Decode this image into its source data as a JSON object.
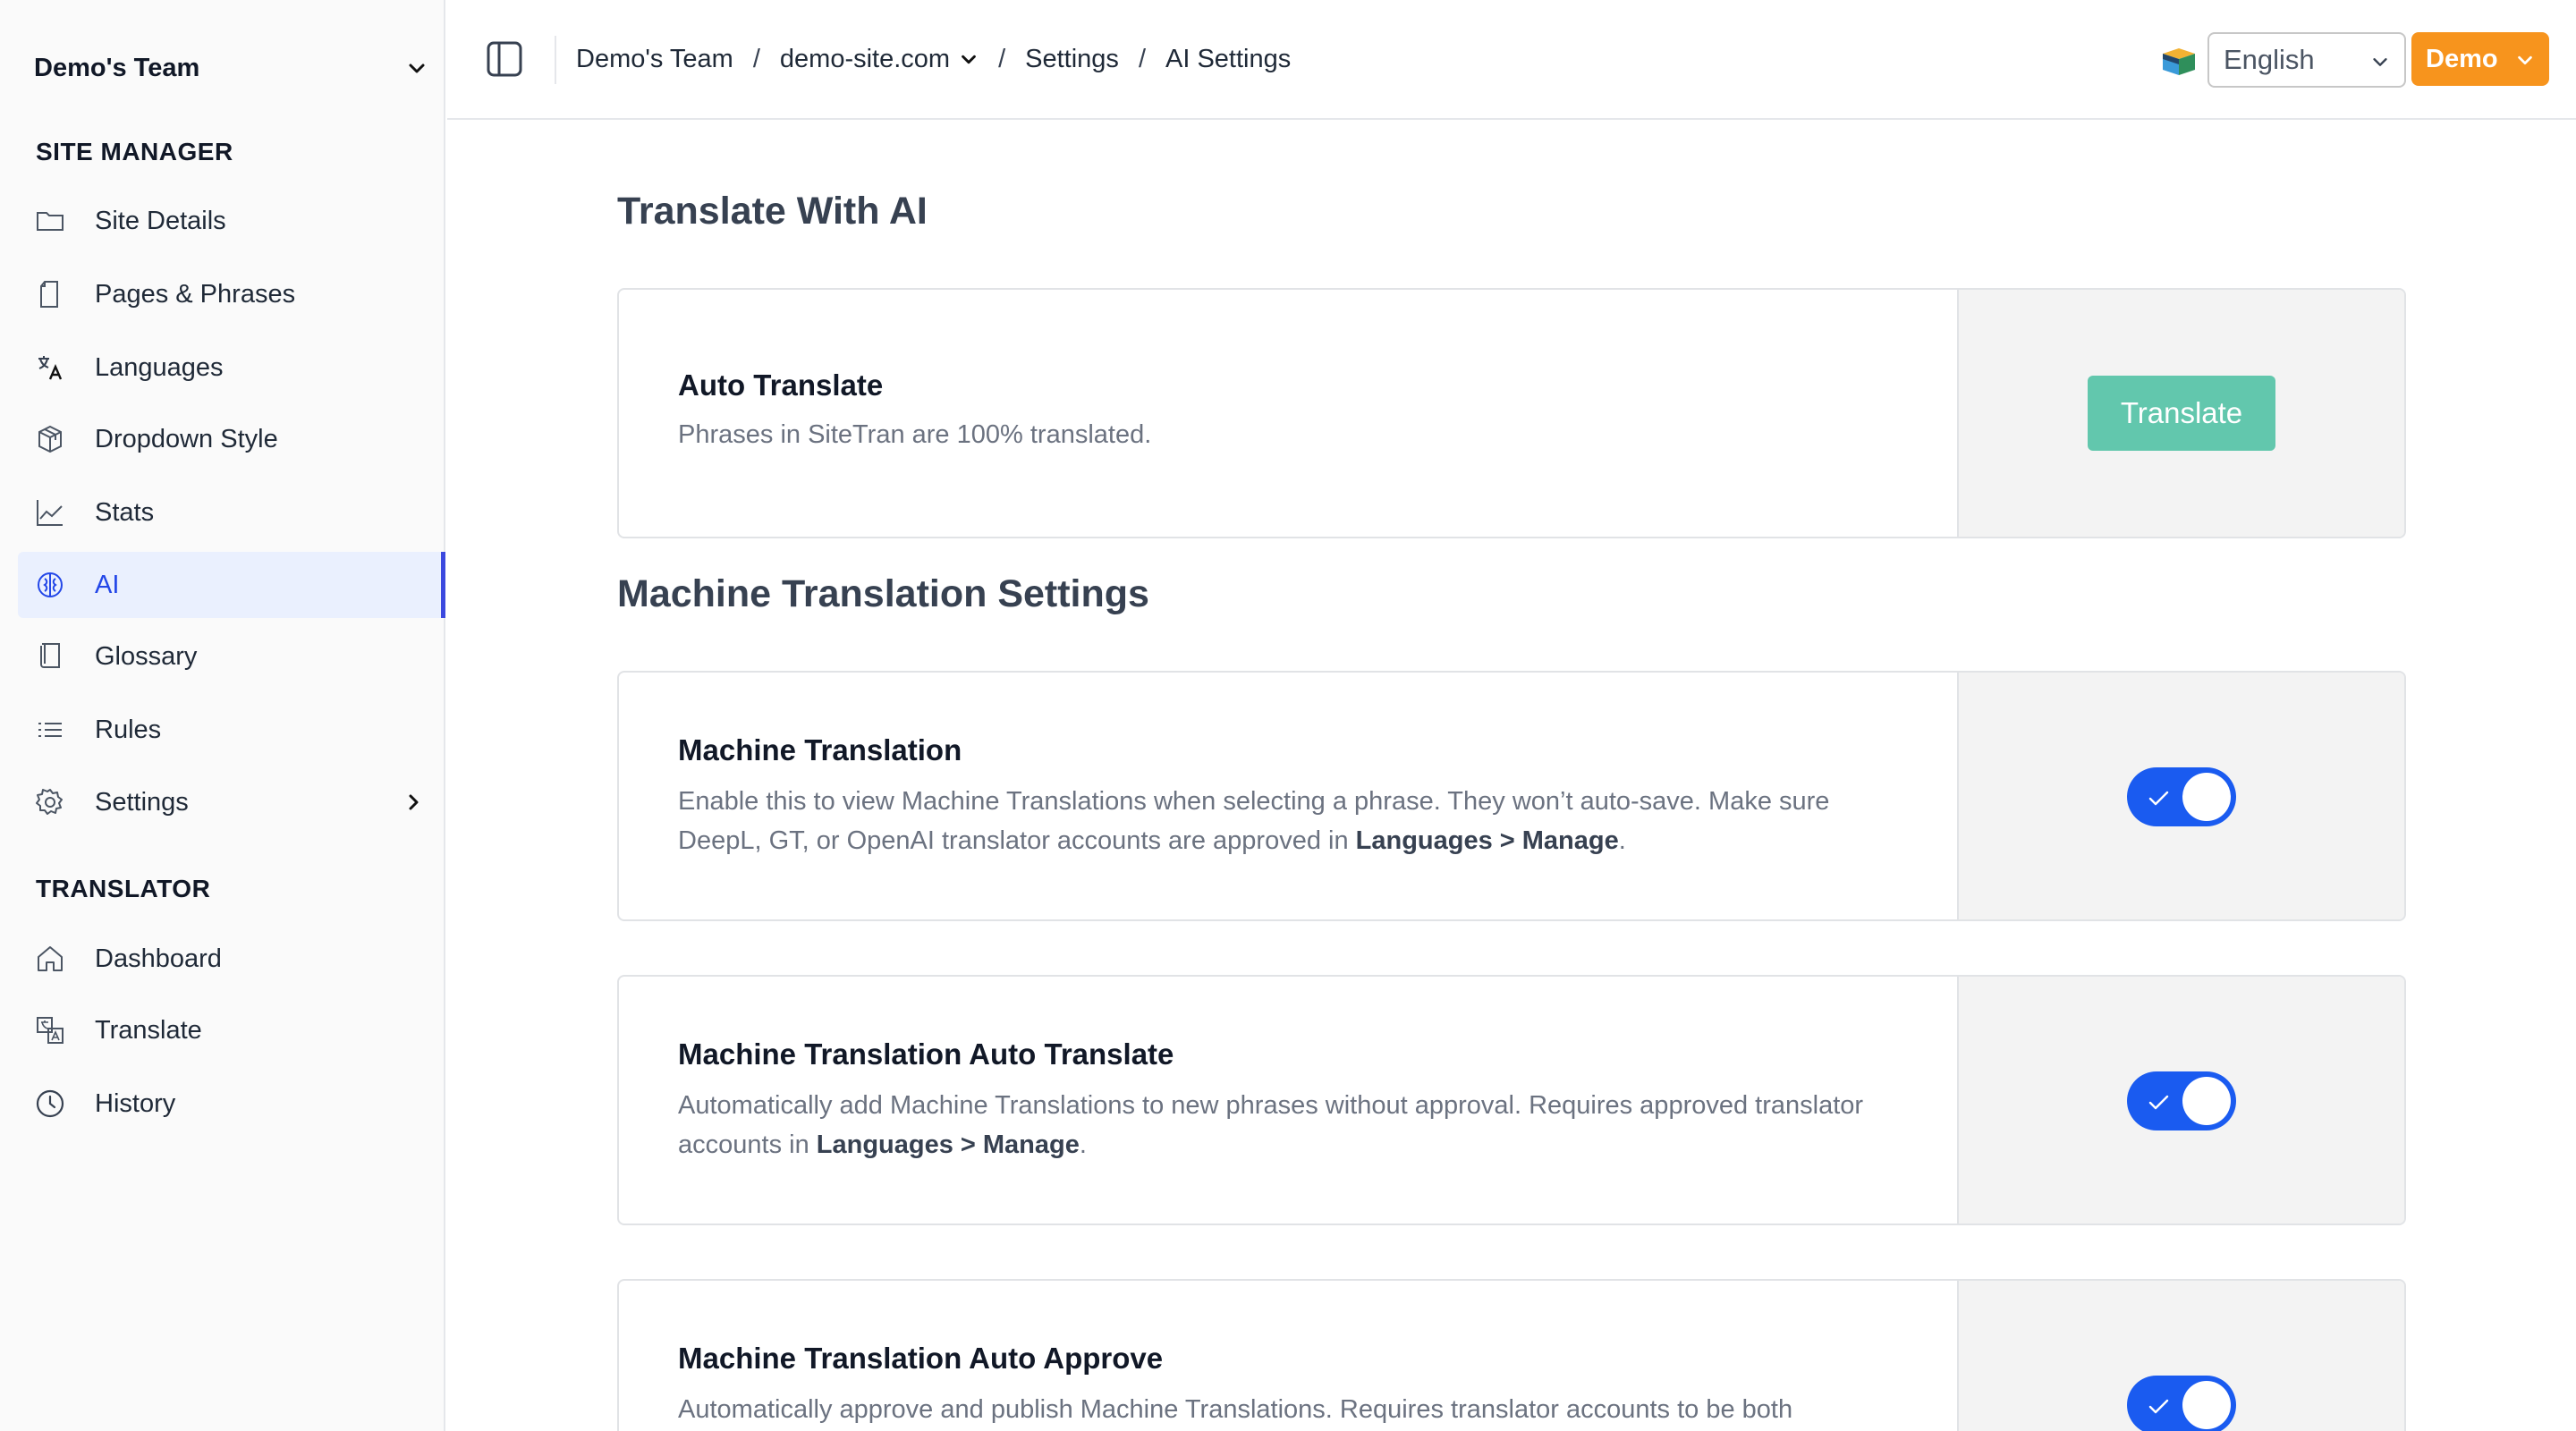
{
  "sidebar": {
    "team_name": "Demo's Team",
    "sections": [
      {
        "title": "SITE MANAGER"
      },
      {
        "title": "TRANSLATOR"
      }
    ],
    "items": [
      {
        "label": "Site Details",
        "icon": "folder-icon"
      },
      {
        "label": "Pages & Phrases",
        "icon": "page-icon"
      },
      {
        "label": "Languages",
        "icon": "language-icon"
      },
      {
        "label": "Dropdown Style",
        "icon": "cube-icon"
      },
      {
        "label": "Stats",
        "icon": "chart-line-icon"
      },
      {
        "label": "AI",
        "icon": "brain-icon",
        "active": true
      },
      {
        "label": "Glossary",
        "icon": "book-icon"
      },
      {
        "label": "Rules",
        "icon": "list-icon"
      },
      {
        "label": "Settings",
        "icon": "gear-icon"
      },
      {
        "label": "Dashboard",
        "icon": "home-icon"
      },
      {
        "label": "Translate",
        "icon": "translate-icon"
      },
      {
        "label": "History",
        "icon": "clock-icon"
      }
    ]
  },
  "topbar": {
    "breadcrumb": [
      "Demo's Team",
      "demo-site.com",
      "Settings",
      "AI Settings"
    ],
    "language": "English",
    "user_button": "Demo"
  },
  "main": {
    "section1_title": "Translate With AI",
    "auto_translate": {
      "title": "Auto Translate",
      "desc": "Phrases in SiteTran are 100% translated.",
      "button": "Translate"
    },
    "section2_title": "Machine Translation Settings",
    "cards": [
      {
        "title": "Machine Translation",
        "desc_pre": "Enable this to view Machine Translations when selecting a phrase. They won’t auto-save. Make sure DeepL, GT, or OpenAI translator accounts are approved in ",
        "desc_bold": "Languages > Manage",
        "desc_post": ".",
        "enabled": true
      },
      {
        "title": "Machine Translation Auto Translate",
        "desc_pre": "Automatically add Machine Translations to new phrases without approval. Requires approved translator accounts in ",
        "desc_bold": "Languages > Manage",
        "desc_post": ".",
        "enabled": true
      },
      {
        "title": "Machine Translation Auto Approve",
        "desc_pre": "Automatically approve and publish Machine Translations. Requires translator accounts to be both",
        "desc_bold": "",
        "desc_post": "",
        "enabled": true
      }
    ]
  },
  "colors": {
    "accent": "#1a5bf0",
    "active_nav_bg": "#eaf0fe",
    "active_nav_text": "#2347e8",
    "demo_button": "#f7941d",
    "translate_button": "#62c7ad"
  }
}
